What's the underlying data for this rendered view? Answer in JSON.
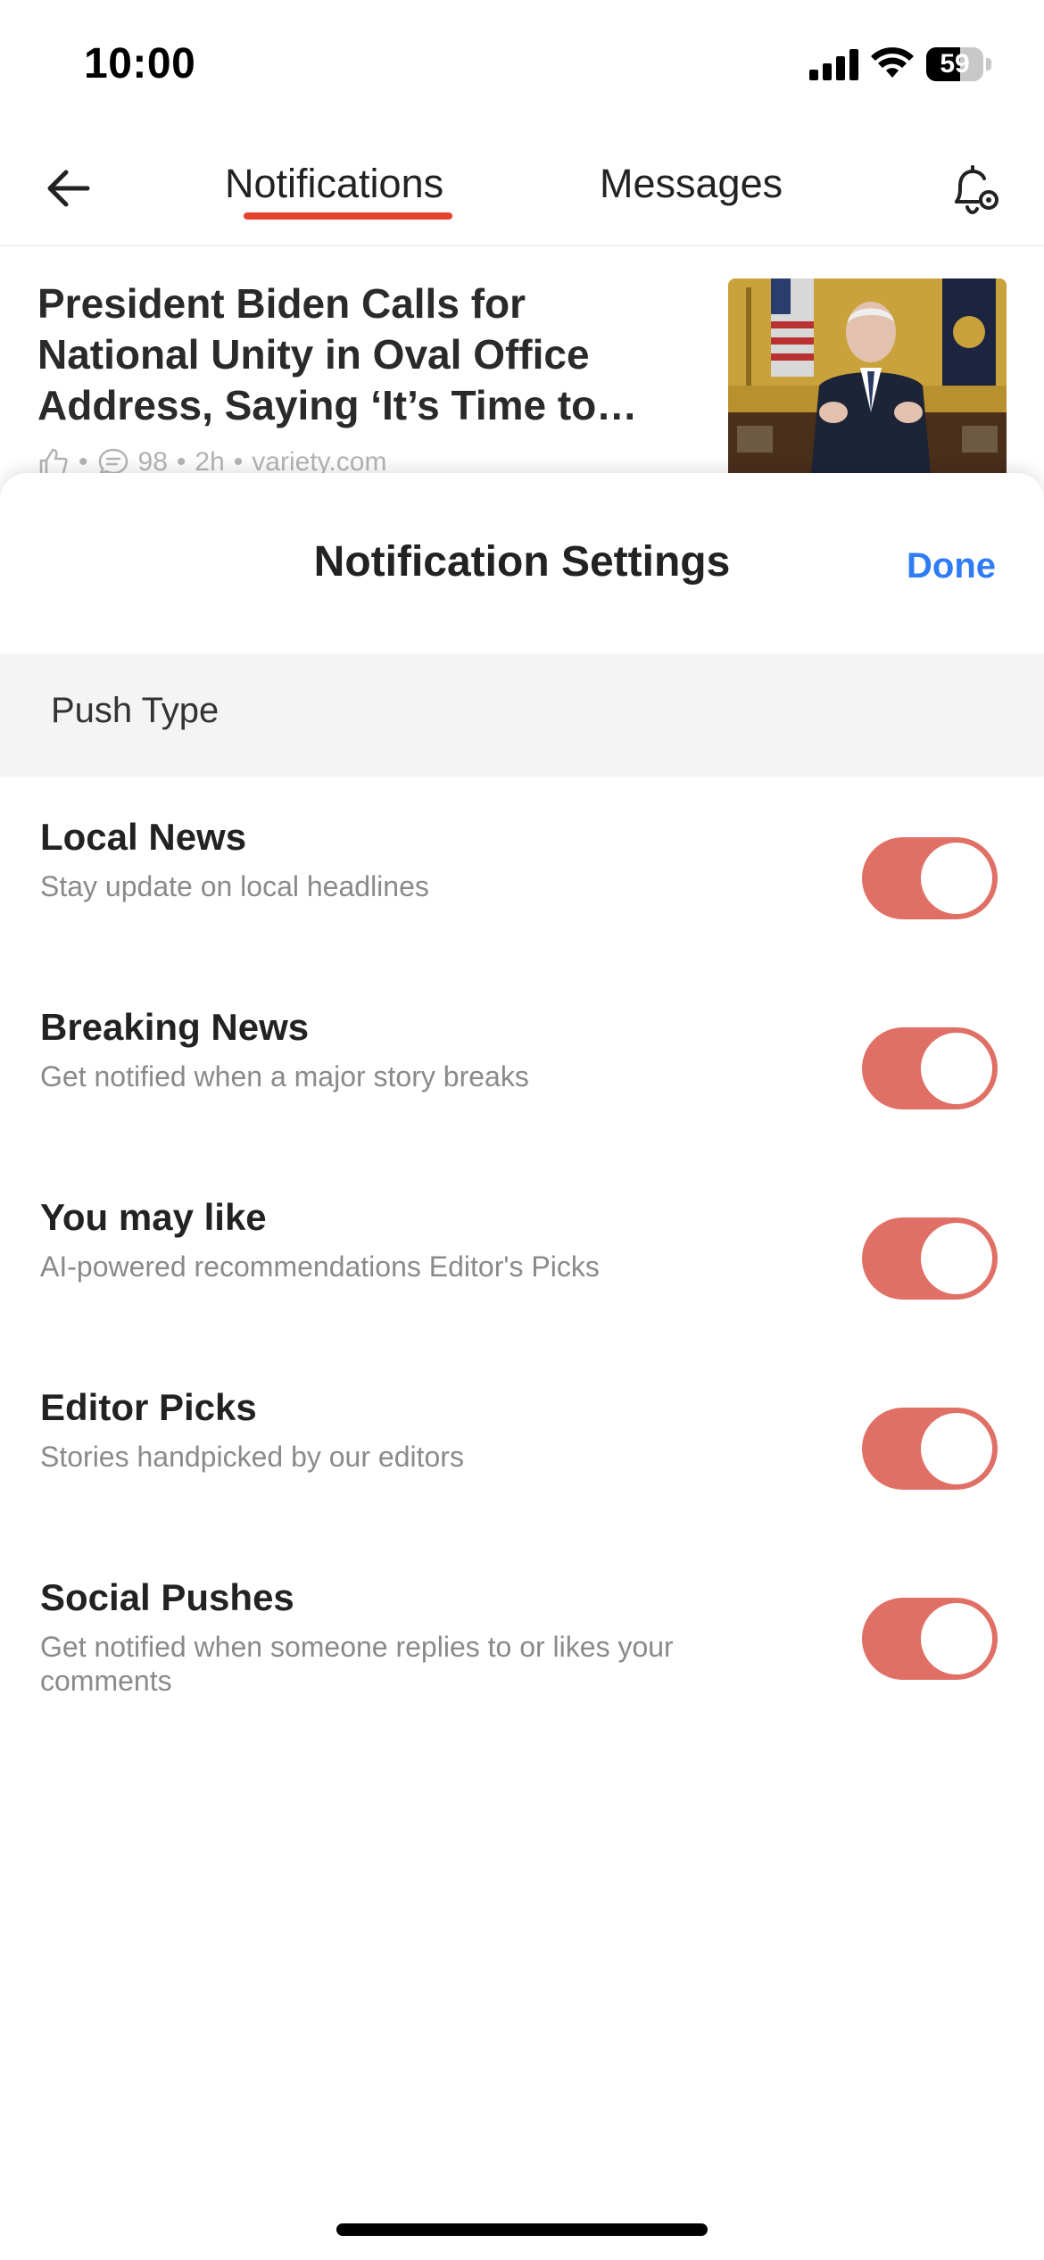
{
  "status_bar": {
    "time": "10:00",
    "battery_level": "59",
    "battery_fraction": 0.59
  },
  "top_nav": {
    "back_icon": "arrow-left-icon",
    "tabs": [
      {
        "label": "Notifications",
        "active": true
      },
      {
        "label": "Messages",
        "active": false
      }
    ],
    "settings_icon": "bell-gear-icon",
    "accent_color": "#e4442f"
  },
  "article": {
    "title": "President Biden Calls for National Unity in Oval Office Address, Saying ‘It’s Time to…",
    "like_icon": "thumbs-up-icon",
    "comment_icon": "comment-icon",
    "comment_count": "98",
    "age": "2h",
    "source": "variety.com"
  },
  "sheet": {
    "title": "Notification Settings",
    "done_label": "Done",
    "section_label": "Push Type",
    "toggle_on_color": "#e07066",
    "settings": [
      {
        "title": "Local News",
        "description": "Stay update on local headlines",
        "enabled": true
      },
      {
        "title": "Breaking News",
        "description": "Get notified when a major story breaks",
        "enabled": true
      },
      {
        "title": "You may like",
        "description": "AI-powered recommendations Editor's Picks",
        "enabled": true
      },
      {
        "title": "Editor Picks",
        "description": "Stories handpicked by our editors",
        "enabled": true
      },
      {
        "title": "Social Pushes",
        "description": "Get notified when someone replies to or likes your comments",
        "enabled": true
      }
    ]
  }
}
